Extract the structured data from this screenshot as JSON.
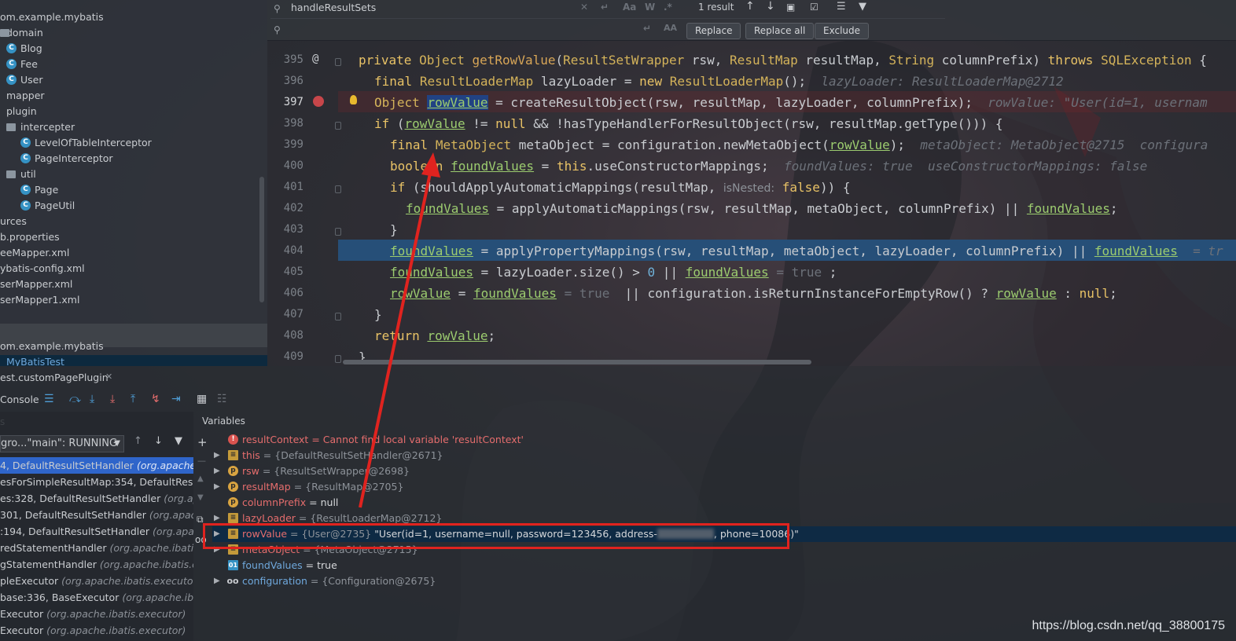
{
  "colors": {
    "accent": "#4f9fd8",
    "selection": "#264f78",
    "breakpoint": "#c7464a",
    "annotation_red": "#e0231f"
  },
  "project_tree": {
    "items": [
      {
        "label": "om.example.mybatis",
        "icon": "none"
      },
      {
        "label": "domain",
        "icon": "folder-icon"
      },
      {
        "label": "Blog",
        "icon": "class-icon"
      },
      {
        "label": "Fee",
        "icon": "class-icon"
      },
      {
        "label": "User",
        "icon": "class-icon"
      },
      {
        "label": "mapper",
        "icon": "folder-icon"
      },
      {
        "label": "plugin",
        "icon": "folder-icon"
      },
      {
        "label": "intercepter",
        "icon": "folder-icon"
      },
      {
        "label": "LevelOfTableInterceptor",
        "icon": "class-icon"
      },
      {
        "label": "PageInterceptor",
        "icon": "class-icon"
      },
      {
        "label": "util",
        "icon": "folder-icon"
      },
      {
        "label": "Page",
        "icon": "class-icon"
      },
      {
        "label": "PageUtil",
        "icon": "class-icon"
      },
      {
        "label": "urces",
        "icon": "none"
      },
      {
        "label": "b.properties",
        "icon": "none"
      },
      {
        "label": "eeMapper.xml",
        "icon": "none"
      },
      {
        "label": "ybatis-config.xml",
        "icon": "none"
      },
      {
        "label": "serMapper.xml",
        "icon": "none"
      },
      {
        "label": "serMapper1.xml",
        "icon": "none"
      }
    ],
    "lower": {
      "package": "om.example.mybatis",
      "selected": "MyBatisTest"
    }
  },
  "search": {
    "query": "handleResultSets",
    "replace_value": "",
    "result_count": "1 result",
    "opt_case": "Aa",
    "opt_word": "W",
    "opt_regex": ".*",
    "replace_label": "Replace",
    "replace_all_label": "Replace all",
    "exclude_label": "Exclude"
  },
  "editor": {
    "line_numbers": [
      "395",
      "396",
      "397",
      "398",
      "399",
      "400",
      "401",
      "402",
      "403",
      "404",
      "405",
      "406",
      "407",
      "408",
      "409"
    ]
  },
  "debug": {
    "tab_label": "est.customPagePlugin",
    "console_label": "Console",
    "frames_label": "s",
    "variables_label": "Variables",
    "thread": "gro...\"main\": RUNNING",
    "frames": [
      {
        "method": "4, DefaultResultSetHandler",
        "pkg": "(org.apache.ib"
      },
      {
        "method": "esForSimpleResultMap:354, DefaultResultS",
        "pkg": ""
      },
      {
        "method": "es:328, DefaultResultSetHandler",
        "pkg": "(org.apach"
      },
      {
        "method": "301, DefaultResultSetHandler",
        "pkg": "(org.apache"
      },
      {
        "method": ":194, DefaultResultSetHandler",
        "pkg": "(org.apach"
      },
      {
        "method": "redStatementHandler",
        "pkg": "(org.apache.ibatis.ex"
      },
      {
        "method": "gStatementHandler",
        "pkg": "(org.apache.ibatis.exe"
      },
      {
        "method": "pleExecutor",
        "pkg": "(org.apache.ibatis.executor)"
      },
      {
        "method": "base:336, BaseExecutor",
        "pkg": "(org.apache.ibatis."
      },
      {
        "method": "Executor",
        "pkg": "(org.apache.ibatis.executor)"
      },
      {
        "method": "Executor",
        "pkg": "(org.apache.ibatis.executor)"
      }
    ],
    "variables": [
      {
        "name": "resultContext",
        "meta": "",
        "value": "= Cannot find local variable 'resultContext'",
        "icon": "error-icon",
        "expandable": false
      },
      {
        "name": "this",
        "meta": "= {DefaultResultSetHandler@2671}",
        "value": "",
        "icon": "field-icon",
        "expandable": true
      },
      {
        "name": "rsw",
        "meta": "= {ResultSetWrapper@2698}",
        "value": "",
        "icon": "param-icon",
        "expandable": true
      },
      {
        "name": "resultMap",
        "meta": "= {ResultMap@2705}",
        "value": "",
        "icon": "param-icon",
        "expandable": true
      },
      {
        "name": "columnPrefix",
        "meta": "",
        "value": "= null",
        "icon": "param-icon",
        "expandable": false
      },
      {
        "name": "lazyLoader",
        "meta": "= {ResultLoaderMap@2712}",
        "value": "",
        "icon": "field-icon",
        "expandable": true
      },
      {
        "name": "rowValue",
        "meta": "= {User@2735}",
        "value": "\"User(id=1, username=null, password=123456, address-",
        "value2": ", phone=10086)\"",
        "icon": "field-icon",
        "expandable": true
      },
      {
        "name": "metaObject",
        "meta": "= {MetaObject@2715}",
        "value": "",
        "icon": "field-icon",
        "expandable": true
      },
      {
        "name": "foundValues",
        "meta": "",
        "value": "= true",
        "icon": "bool-icon",
        "expandable": false
      },
      {
        "name": "configuration",
        "meta": "= {Configuration@2675}",
        "value": "",
        "icon": "oo-icon",
        "expandable": true
      }
    ]
  },
  "watermark": "https://blog.csdn.net/qq_38800175"
}
